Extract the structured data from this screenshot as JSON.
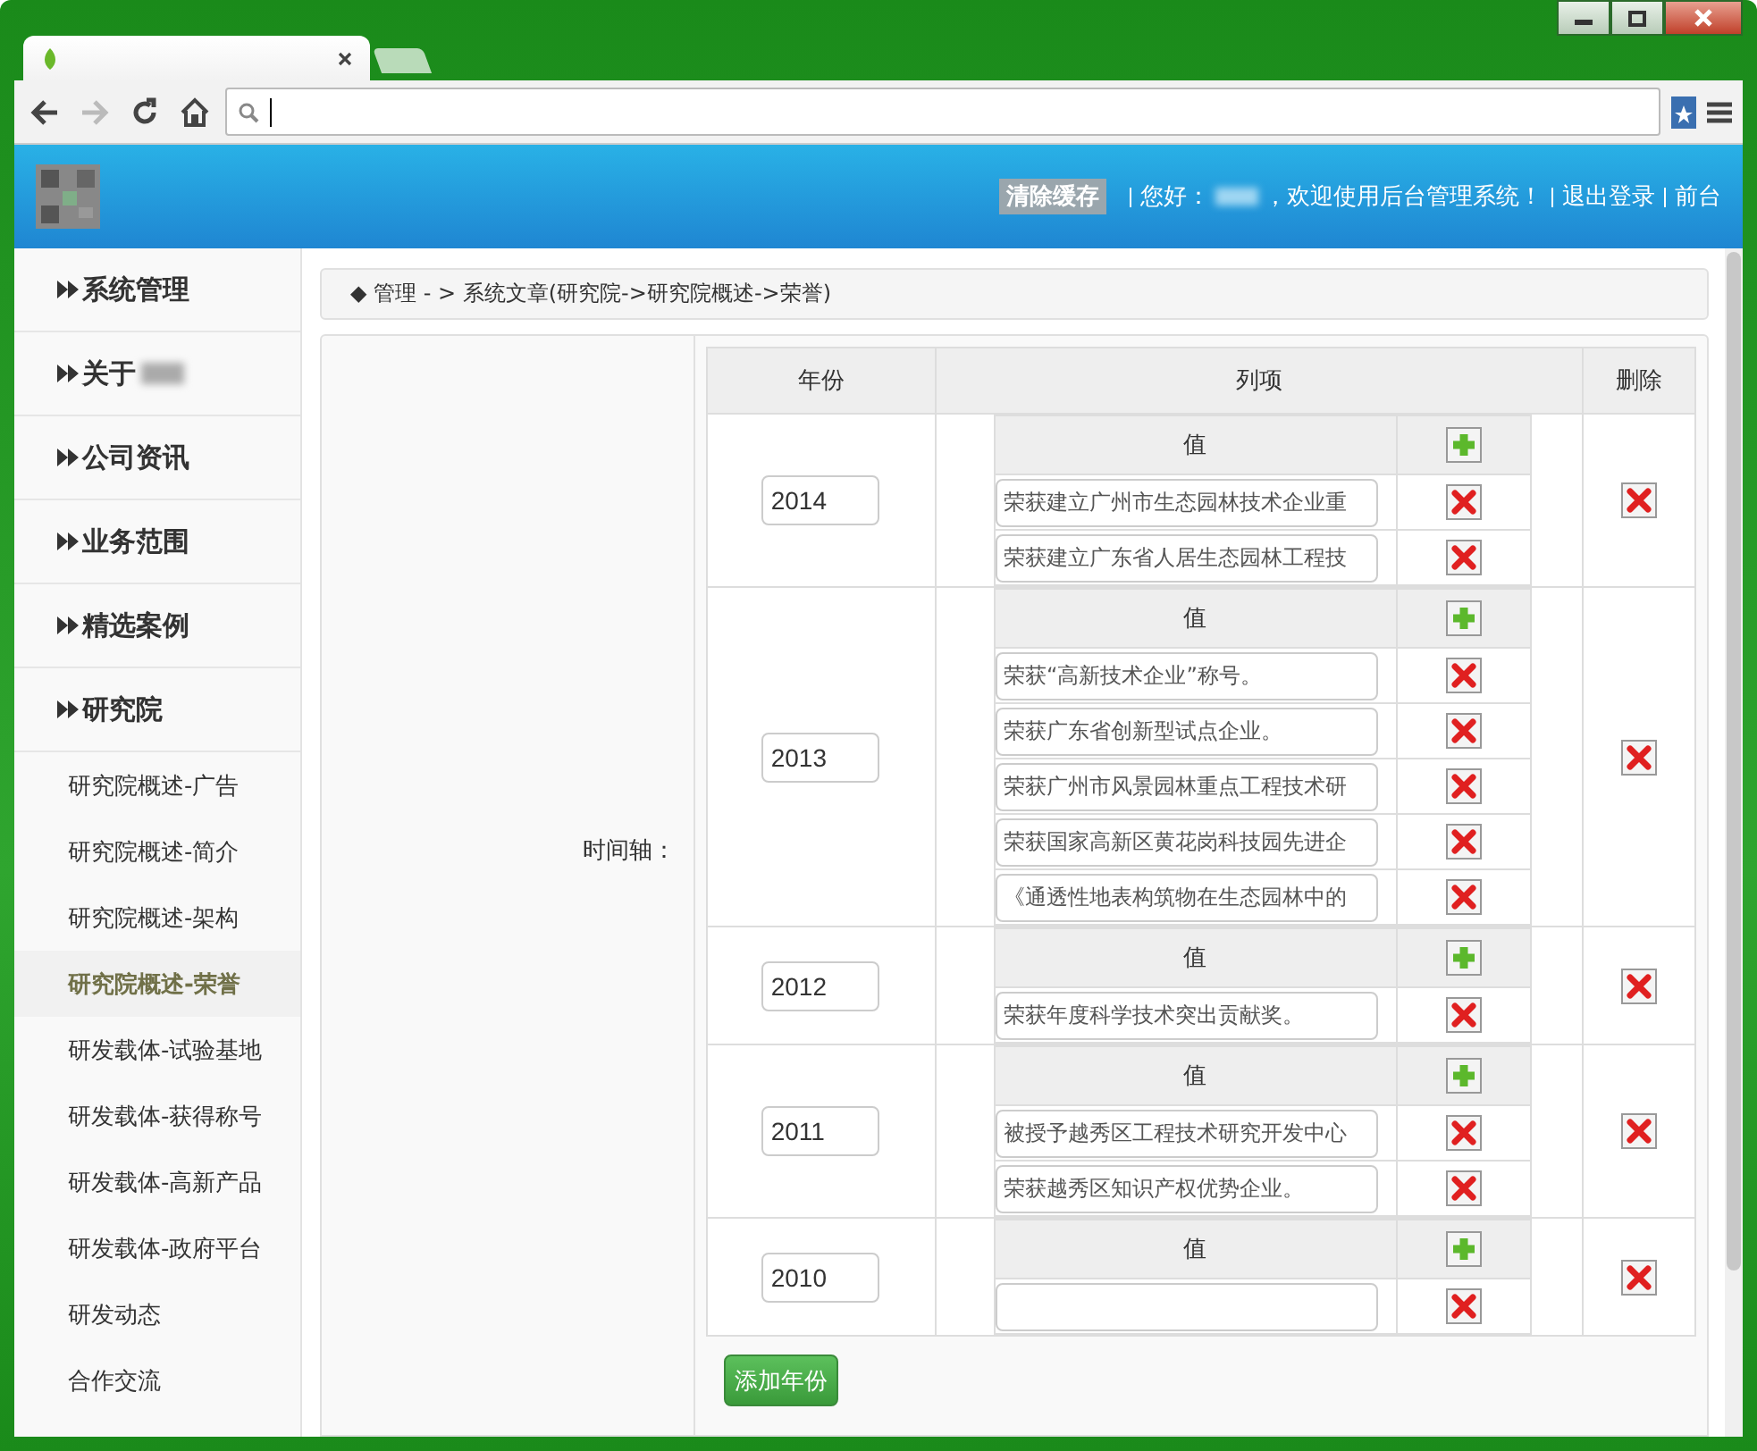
{
  "browser": {
    "tabs": [
      {
        "kind": "page",
        "selected": true
      },
      {
        "kind": "new",
        "selected": false
      }
    ],
    "nav_buttons": [
      {
        "kind": "back",
        "disabled": false
      },
      {
        "kind": "forward",
        "disabled": true
      },
      {
        "kind": "reload",
        "disabled": false
      },
      {
        "kind": "home",
        "disabled": false
      }
    ]
  },
  "header": {
    "clear_cache_button": "清除缓存",
    "greeting": "您好：",
    "welcome": "，欢迎使用后台管理系统！",
    "links": [
      "退出登录",
      "前台"
    ]
  },
  "sidebar": {
    "items": [
      {
        "kind": "section",
        "label": "系统管理",
        "selected": false
      },
      {
        "kind": "section",
        "label": "关于",
        "selected": false,
        "redacted": true
      },
      {
        "kind": "section",
        "label": "公司资讯",
        "selected": false
      },
      {
        "kind": "section",
        "label": "业务范围",
        "selected": false
      },
      {
        "kind": "section",
        "label": "精选案例",
        "selected": false
      },
      {
        "kind": "section",
        "label": "研究院",
        "selected": false
      },
      {
        "kind": "sub",
        "label": "研究院概述-广告",
        "selected": false
      },
      {
        "kind": "sub",
        "label": "研究院概述-简介",
        "selected": false
      },
      {
        "kind": "sub",
        "label": "研究院概述-架构",
        "selected": false
      },
      {
        "kind": "sub",
        "label": "研究院概述-荣誉",
        "selected": true
      },
      {
        "kind": "sub",
        "label": "研发载体-试验基地",
        "selected": false
      },
      {
        "kind": "sub",
        "label": "研发载体-获得称号",
        "selected": false
      },
      {
        "kind": "sub",
        "label": "研发载体-高新产品",
        "selected": false
      },
      {
        "kind": "sub",
        "label": "研发载体-政府平台",
        "selected": false
      },
      {
        "kind": "sub",
        "label": "研发动态",
        "selected": false
      },
      {
        "kind": "sub",
        "label": "合作交流",
        "selected": false
      }
    ]
  },
  "breadcrumb": "◆ 管理 - > 系统文章(研究院->研究院概述->荣誉)",
  "form": {
    "label": "时间轴：",
    "table": {
      "columns": [
        "年份",
        "列项",
        "删除"
      ],
      "rows": [
        {
          "year": "2014",
          "value_header": "值",
          "items": [
            {
              "kind": "text",
              "value": "荣获建立广州市生态园林技术企业重"
            },
            {
              "kind": "text",
              "value": "荣获建立广东省人居生态园林工程技"
            }
          ]
        },
        {
          "year": "2013",
          "value_header": "值",
          "items": [
            {
              "kind": "text",
              "value": "荣获“高新技术企业”称号。"
            },
            {
              "kind": "text",
              "value": "荣获广东省创新型试点企业。"
            },
            {
              "kind": "text",
              "value": "荣获广州市风景园林重点工程技术研"
            },
            {
              "kind": "text",
              "value": "荣获国家高新区黄花岗科技园先进企"
            },
            {
              "kind": "text",
              "value": "《通透性地表构筑物在生态园林中的"
            }
          ]
        },
        {
          "year": "2012",
          "value_header": "值",
          "items": [
            {
              "kind": "text",
              "value": "荣获年度科学技术突出贡献奖。"
            }
          ]
        },
        {
          "year": "2011",
          "value_header": "值",
          "items": [
            {
              "kind": "text",
              "value": "被授予越秀区工程技术研究开发中心"
            },
            {
              "kind": "text",
              "value": "荣获越秀区知识产权优势企业。"
            }
          ]
        },
        {
          "year": "2010",
          "value_header": "值",
          "items": [
            {
              "kind": "empty"
            }
          ]
        }
      ]
    },
    "add_button": "添加年份"
  }
}
